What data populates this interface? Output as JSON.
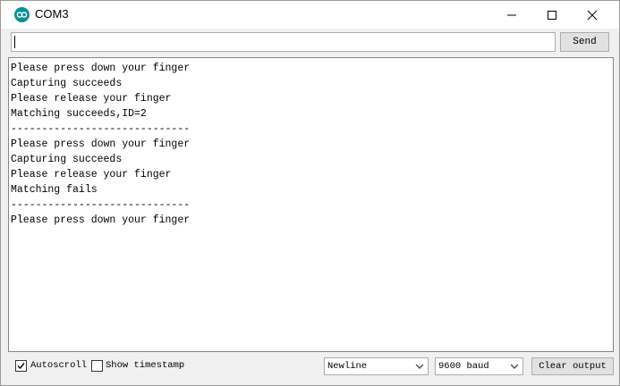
{
  "window": {
    "title": "COM3",
    "app_icon": "arduino-infinity-icon",
    "controls": [
      "minimize-icon",
      "maximize-icon",
      "close-icon"
    ]
  },
  "input": {
    "value": "",
    "send_label": "Send"
  },
  "output": {
    "lines": [
      "Please press down your finger",
      "Capturing succeeds",
      "Please release your finger",
      "Matching succeeds,ID=2",
      "-----------------------------",
      "Please press down your finger",
      "Capturing succeeds",
      "Please release your finger",
      "Matching fails",
      "-----------------------------",
      "Please press down your finger"
    ]
  },
  "footer": {
    "autoscroll_label": "Autoscroll",
    "autoscroll_checked": true,
    "timestamp_label": "Show timestamp",
    "timestamp_checked": false,
    "line_ending": "Newline",
    "baud": "9600 baud",
    "clear_label": "Clear output"
  }
}
